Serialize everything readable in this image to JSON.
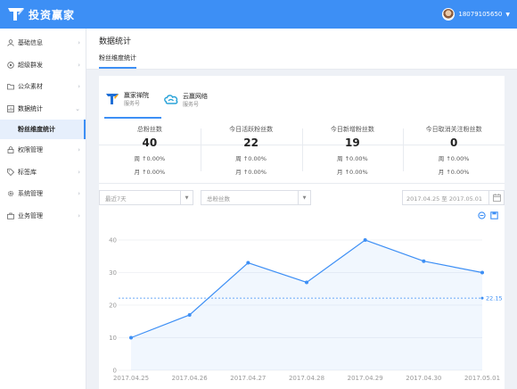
{
  "app": {
    "logo_text": "投资赢家"
  },
  "user": {
    "phone": "18079105650"
  },
  "sidebar": {
    "items": [
      {
        "label": "基础信息",
        "icon": "user-icon"
      },
      {
        "label": "超级群发",
        "icon": "broadcast-icon"
      },
      {
        "label": "公众素材",
        "icon": "folder-icon"
      },
      {
        "label": "数据统计",
        "icon": "chart-icon"
      },
      {
        "label": "权限管理",
        "icon": "lock-icon"
      },
      {
        "label": "标签库",
        "icon": "tag-icon"
      },
      {
        "label": "系统管理",
        "icon": "gear-icon"
      },
      {
        "label": "业务管理",
        "icon": "briefcase-icon"
      }
    ],
    "active_sub": "粉丝维度统计"
  },
  "page": {
    "title": "数据统计",
    "sub_tab": "粉丝维度统计"
  },
  "accounts": [
    {
      "name": "赢家禅院",
      "type": "服务号"
    },
    {
      "name": "云赢网络",
      "type": "服务号"
    }
  ],
  "stats": [
    {
      "label": "总粉丝数",
      "value": "40",
      "week": "周 ↑0.00%",
      "month": "月 ↑0.00%"
    },
    {
      "label": "今日活跃粉丝数",
      "value": "22",
      "week": "周 ↑0.00%",
      "month": "月 ↑0.00%"
    },
    {
      "label": "今日新增粉丝数",
      "value": "19",
      "week": "周 ↑0.00%",
      "month": "月 ↑0.00%"
    },
    {
      "label": "今日取消关注粉丝数",
      "value": "0",
      "week": "周 ↑0.00%",
      "month": "月 ↑0.00%"
    }
  ],
  "filters": {
    "period": "最近7天",
    "metric": "总粉丝数",
    "date_range": "2017.04.25 至 2017.05.01"
  },
  "colors": {
    "accent": "#3d8ff5",
    "topbar": "#3d8ff5"
  },
  "chart_data": {
    "type": "line",
    "categories": [
      "2017.04.25",
      "2017.04.26",
      "2017.04.27",
      "2017.04.28",
      "2017.04.29",
      "2017.04.30",
      "2017.05.01"
    ],
    "values": [
      10,
      17,
      33,
      27,
      40,
      33.5,
      30
    ],
    "ylim": [
      0,
      40
    ],
    "yticks": [
      0,
      10,
      20,
      30,
      40
    ],
    "average_line": {
      "value": 22.15,
      "label": "22.15"
    },
    "grid": "horizontal"
  }
}
